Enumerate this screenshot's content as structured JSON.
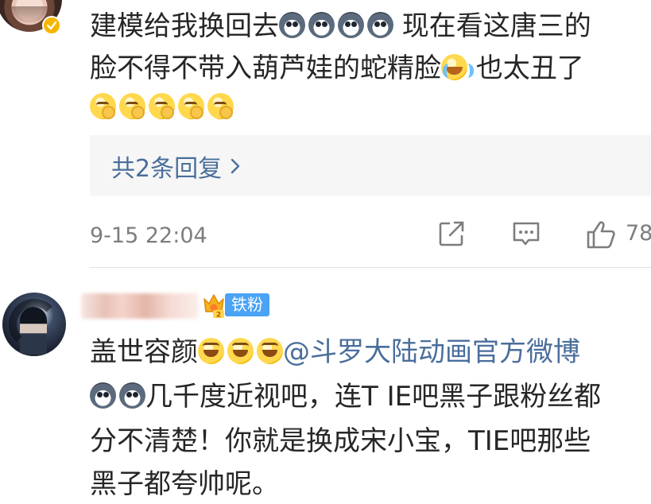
{
  "comment1": {
    "avatar": "user-avatar",
    "badge_icon": "verified-check-icon",
    "line1_a": "建模给我换回去",
    "line1_b": " 现在看这唐三的",
    "line2_a": "脸不得不带入葫芦娃的蛇精脸",
    "line2_b": " 也太丑了",
    "emoji_dog": "husky-emoji",
    "emoji_cry": "crying-emoji",
    "emoji_think": "thinking-emoji",
    "reply_link": "共2条回复",
    "timestamp": "9-15 22:04",
    "like_count": "78",
    "actions": [
      "share-icon",
      "comment-icon",
      "like-icon"
    ]
  },
  "comment2": {
    "avatar": "user-avatar",
    "fan_badge": "铁粉",
    "fan_icon": "crown-icon",
    "line1_a": "盖世容颜",
    "mention": "@斗罗大陆动画官方微博",
    "line2": "几千度近视吧，连T IE吧黑子跟粉丝都",
    "line3": "分不清楚！你就是换成宋小宝，TIE吧那些",
    "line4": "黑子都夸帅呢。",
    "emoji_grin": "grinning-emoji"
  },
  "colors": {
    "link": "#4a6e9c",
    "meta": "#7d7d7d",
    "badge": "#4aa3f5",
    "verified": "#f7b500"
  }
}
